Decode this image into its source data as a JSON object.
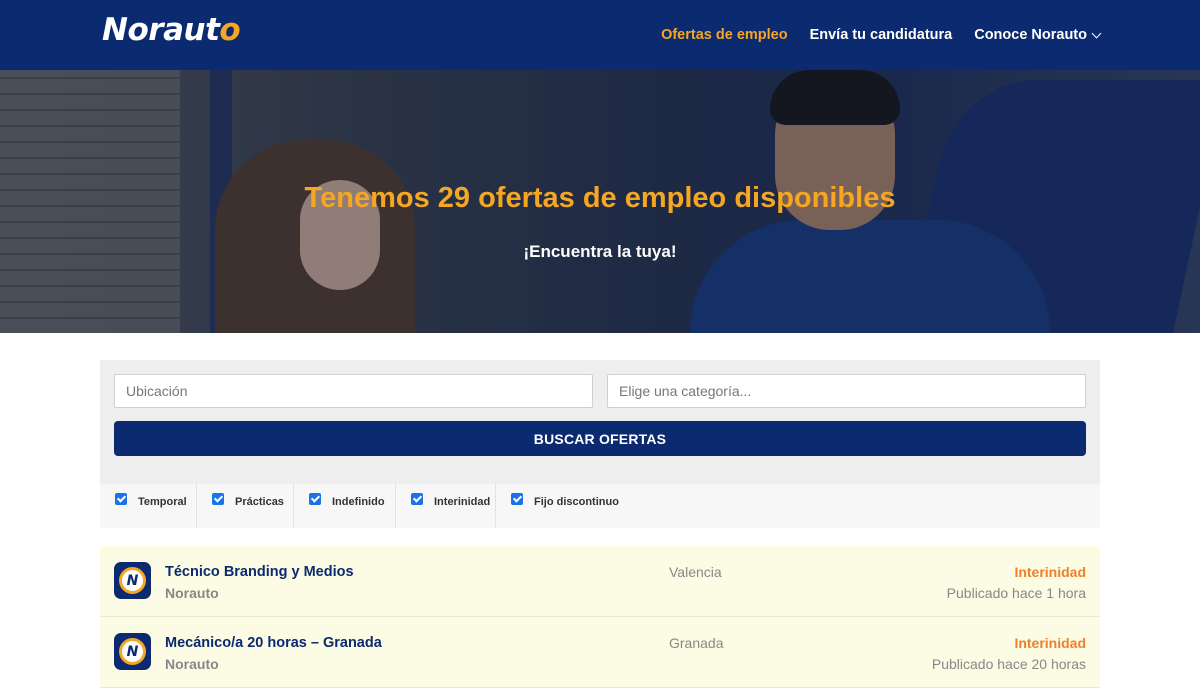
{
  "header": {
    "logo_text": "Norauto",
    "nav": [
      {
        "label": "Ofertas de empleo",
        "active": true
      },
      {
        "label": "Envía tu candidatura",
        "active": false
      },
      {
        "label": "Conoce Norauto",
        "active": false
      }
    ]
  },
  "hero": {
    "title": "Tenemos 29 ofertas de empleo disponibles",
    "subtitle": "¡Encuentra la tuya!"
  },
  "search": {
    "location_placeholder": "Ubicación",
    "category_placeholder": "Elige una categoría...",
    "button_label": "BUSCAR OFERTAS"
  },
  "filters": [
    {
      "label": "Temporal",
      "checked": true
    },
    {
      "label": "Prácticas",
      "checked": true
    },
    {
      "label": "Indefinido",
      "checked": true
    },
    {
      "label": "Interinidad",
      "checked": true
    },
    {
      "label": "Fijo discontinuo",
      "checked": true
    }
  ],
  "jobs": [
    {
      "title": "Técnico Branding y Medios",
      "company": "Norauto",
      "location": "Valencia",
      "type": "Interinidad",
      "posted": "Publicado hace 1 hora"
    },
    {
      "title": "Mecánico/a 20 horas – Granada",
      "company": "Norauto",
      "location": "Granada",
      "type": "Interinidad",
      "posted": "Publicado hace 20 horas"
    }
  ],
  "colors": {
    "brand_navy": "#0b2a6f",
    "accent_orange": "#f5a623",
    "job_type_orange": "#f07f2a",
    "job_row_bg": "#fcfbe3"
  }
}
